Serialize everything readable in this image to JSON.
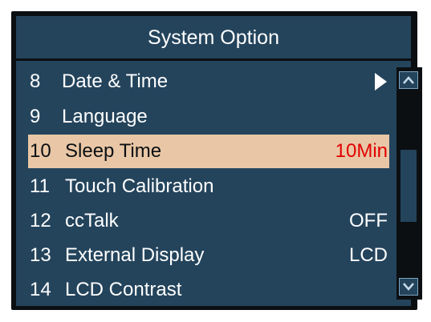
{
  "title": "System Option",
  "colors": {
    "background": "#24445c",
    "frame": "#0b0f12",
    "highlight": "#e9c7a6",
    "highlight_value": "#e00000",
    "text": "#ffffff"
  },
  "items": [
    {
      "num": "8",
      "label": "Date & Time",
      "value": "",
      "has_submenu_arrow": true
    },
    {
      "num": "9",
      "label": "Language",
      "value": ""
    },
    {
      "num": "10",
      "label": "Sleep Time",
      "value": "10Min",
      "selected": true
    },
    {
      "num": "11",
      "label": "Touch Calibration",
      "value": ""
    },
    {
      "num": "12",
      "label": "ccTalk",
      "value": "OFF"
    },
    {
      "num": "13",
      "label": "External Display",
      "value": "LCD"
    },
    {
      "num": "14",
      "label": "LCD Contrast",
      "value": ""
    }
  ],
  "scrollbar": {
    "up_icon": "chevron-up-icon",
    "down_icon": "chevron-down-icon",
    "position_fraction": 0.5
  }
}
